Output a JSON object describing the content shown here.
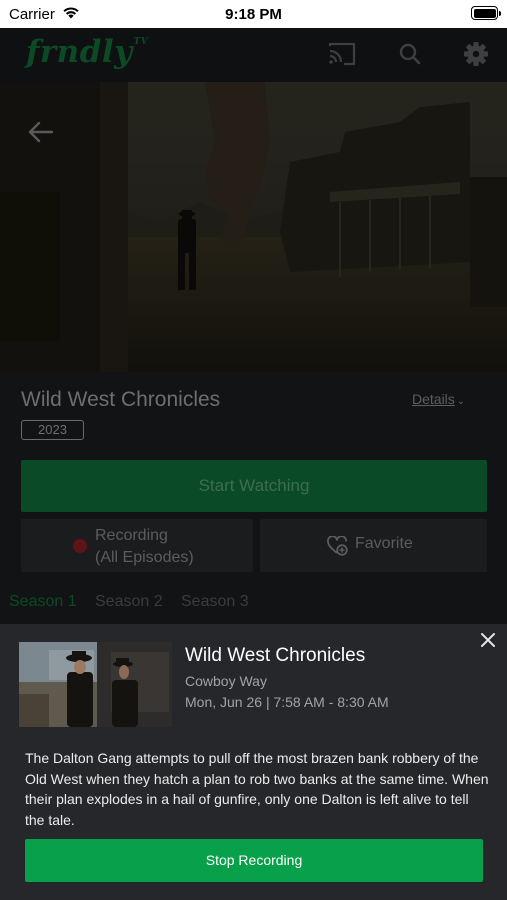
{
  "status_bar": {
    "carrier": "Carrier",
    "time": "9:18 PM"
  },
  "header": {
    "logo_text": "frndly",
    "logo_superscript": "TV"
  },
  "show": {
    "title": "Wild West Chronicles",
    "year": "2023",
    "details_link": "Details"
  },
  "actions": {
    "start_watching": "Start Watching",
    "recording_line1": "Recording",
    "recording_line2": "(All Episodes)",
    "favorite": "Favorite"
  },
  "seasons": [
    "Season 1",
    "Season 2",
    "Season 3"
  ],
  "episode_sheet": {
    "title": "Wild West Chronicles",
    "episode_name": "Cowboy Way",
    "airtime": "Mon, Jun 26 | 7:58 AM - 8:30 AM",
    "description": "The Dalton Gang attempts to pull off the most brazen bank robbery of the Old West when they hatch a plan to rob two banks at the same time. When their plan explodes in a hail of gunfire, only one Dalton is left alive to tell the tale.",
    "stop_recording": "Stop Recording"
  },
  "colors": {
    "accent_green": "#08a04a",
    "recording_red": "#e0262a",
    "sheet_bg": "#26272b"
  },
  "icons": [
    "wifi-icon",
    "battery-icon",
    "cast-icon",
    "search-icon",
    "settings-icon",
    "back-arrow-icon",
    "chevron-down-icon",
    "record-dot-icon",
    "heart-plus-icon",
    "close-icon"
  ]
}
